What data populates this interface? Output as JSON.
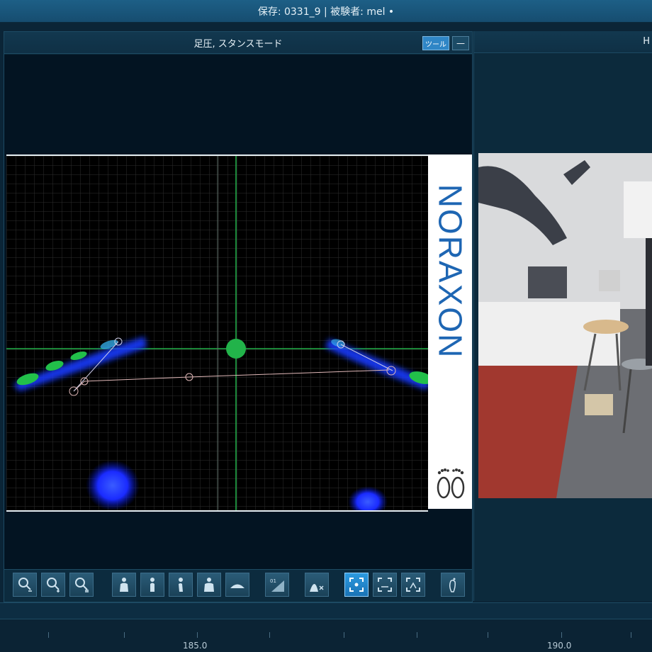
{
  "titlebar": {
    "text": "保存: 0331_9 | 被験者: mel •"
  },
  "panel": {
    "title": "足圧, スタンスモード",
    "tool_button": "ツール",
    "min_button": "—",
    "brand": "NORAXON"
  },
  "right_panel": {
    "title": "H"
  },
  "timeline": {
    "labels": [
      "185.0",
      "190.0"
    ]
  },
  "toolbar": {
    "buttons": [
      "zoom-out",
      "zoom-in",
      "zoom-reset",
      "body-front",
      "body-side",
      "body-side-2",
      "body-back",
      "foot-plate",
      "value-01",
      "peak-x",
      "frame-active",
      "frame-balance",
      "frame-stance",
      "foot-right"
    ]
  },
  "colors": {
    "accent": "#2f86c6",
    "cop": "#22b34a",
    "pressure": "#1a36ff"
  }
}
